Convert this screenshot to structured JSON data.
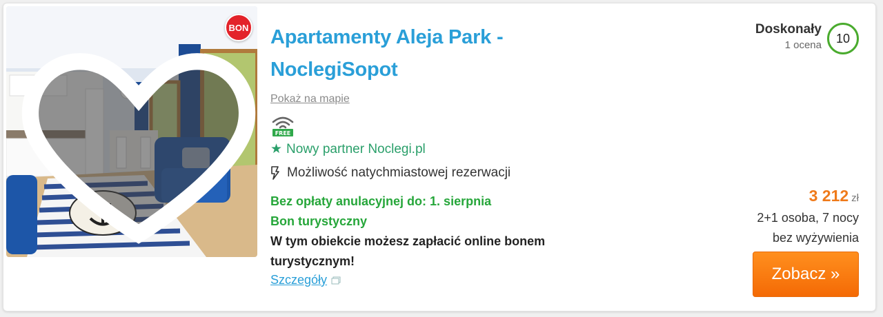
{
  "listing": {
    "title_line1": "Apartamenty Aleja Park -",
    "title_line2": "NoclegiSopot",
    "map_link": "Pokaż na mapie",
    "wifi_badge": "FREE",
    "partner_label": "Nowy partner Noclegi.pl",
    "instant_label": "Możliwość natychmiastowej rezerwacji",
    "cancellation": "Bez opłaty anulacyjnej do: 1. sierpnia",
    "bon_label": "Bon turystyczny",
    "bon_description": "W tym obiekcie możesz zapłacić online bonem turystycznym!",
    "details_link": "Szczegóły",
    "badge": "BON"
  },
  "rating": {
    "label": "Doskonały",
    "count": "1 ocena",
    "score": "10"
  },
  "price": {
    "amount": "3 212",
    "currency": "zł",
    "guests_nights": "2+1 osoba, 7 nocy",
    "board": "bez wyżywienia"
  },
  "cta": {
    "label": "Zobacz »"
  },
  "icons": {
    "favorite": "heart-icon",
    "wifi": "wifi-icon",
    "star": "star-icon",
    "instant": "lightning-icon",
    "external": "external-link-icon"
  },
  "colors": {
    "title": "#2a9fd8",
    "green": "#26a63a",
    "partner": "#2a9f6a",
    "price": "#ef7a1a",
    "button": "#f47a10",
    "badge": "#e3232a",
    "score_ring": "#4aab2e"
  }
}
